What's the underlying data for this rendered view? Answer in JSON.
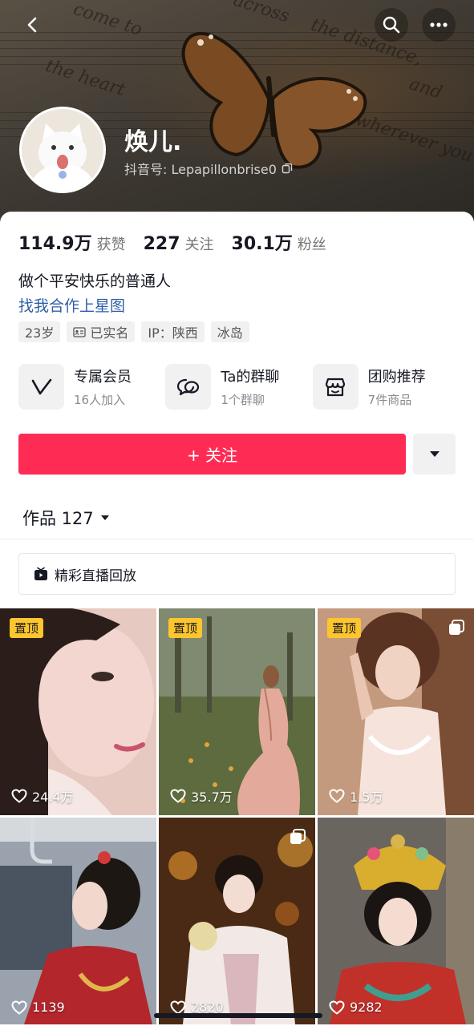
{
  "profile": {
    "name": "焕儿.",
    "douyin_id": "抖音号: Lepapillonbrise0"
  },
  "stats": [
    {
      "num": "114.9万",
      "label": "获赞"
    },
    {
      "num": "227",
      "label": "关注"
    },
    {
      "num": "30.1万",
      "label": "粉丝"
    }
  ],
  "bio": {
    "line1": "做个平安快乐的普通人",
    "link": "找我合作上星图"
  },
  "tags": [
    "23岁",
    "已实名",
    "IP：陕西",
    "冰岛"
  ],
  "features": [
    {
      "title": "专属会员",
      "sub": "16人加入",
      "icon": "v-badge-icon"
    },
    {
      "title": "Ta的群聊",
      "sub": "1个群聊",
      "icon": "chat-bubbles-icon"
    },
    {
      "title": "团购推荐",
      "sub": "7件商品",
      "icon": "shop-icon"
    }
  ],
  "actions": {
    "follow_label": "+ 关注"
  },
  "works": {
    "tab_label": "作品 127",
    "live_replay": "精彩直播回放"
  },
  "banner_text": [
    "come to",
    "the heart",
    "across",
    "the distance,",
    "and",
    "wherever you"
  ],
  "grid": [
    {
      "pinned": true,
      "pin_label": "置顶",
      "likes": "24.4万",
      "multi": false
    },
    {
      "pinned": true,
      "pin_label": "置顶",
      "likes": "35.7万",
      "multi": false
    },
    {
      "pinned": true,
      "pin_label": "置顶",
      "likes": "1.5万",
      "multi": true
    },
    {
      "pinned": false,
      "pin_label": "",
      "likes": "1139",
      "multi": false
    },
    {
      "pinned": false,
      "pin_label": "",
      "likes": "2820",
      "multi": true
    },
    {
      "pinned": false,
      "pin_label": "",
      "likes": "9282",
      "multi": false
    }
  ],
  "colors": {
    "accent": "#fe2c55",
    "link": "#2f5fa7",
    "pin": "#fdc62c"
  }
}
